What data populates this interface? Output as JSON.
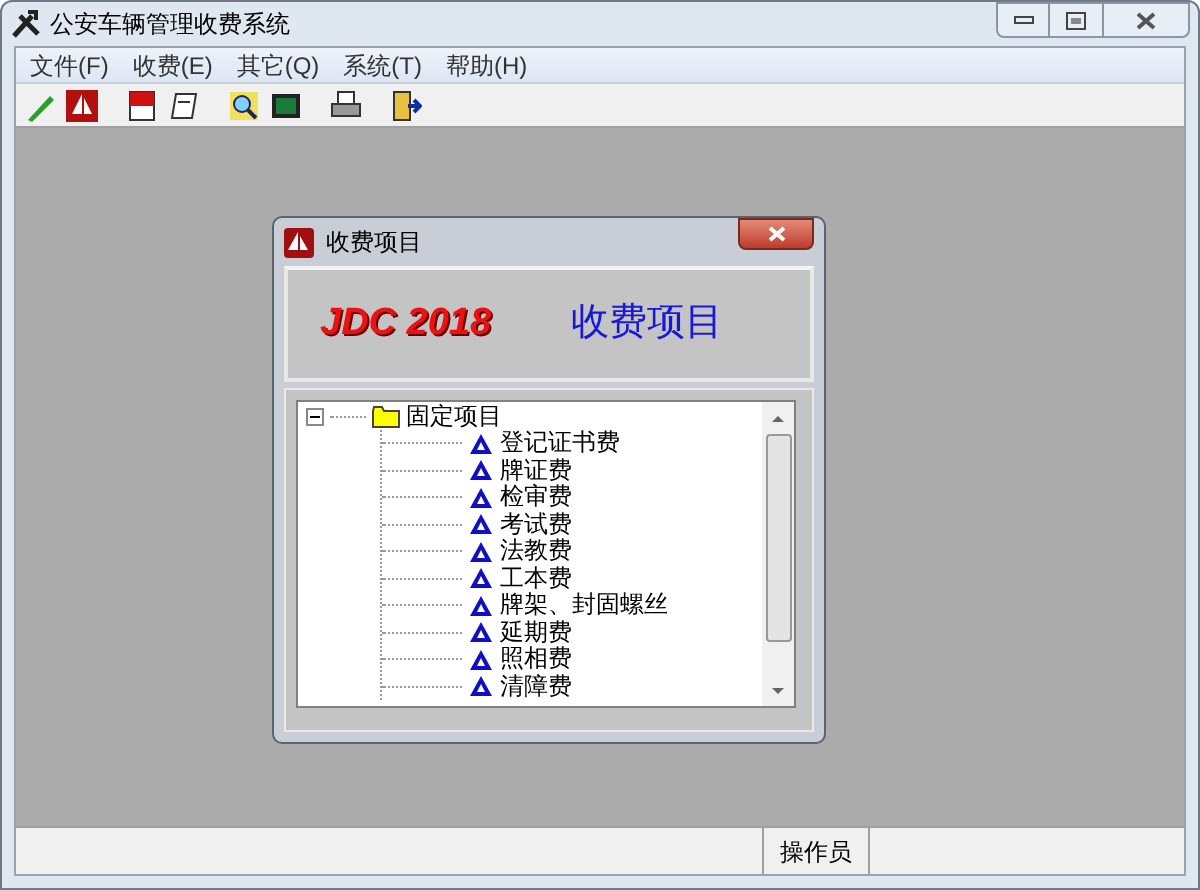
{
  "window": {
    "title": "公安车辆管理收费系统"
  },
  "menu": [
    {
      "label": "文件(F)"
    },
    {
      "label": "收费(E)"
    },
    {
      "label": "其它(Q)"
    },
    {
      "label": "系统(T)"
    },
    {
      "label": "帮助(H)"
    }
  ],
  "dialog": {
    "title": "收费项目",
    "brand": "JDC 2018",
    "heading": "收费项目",
    "tree": [
      {
        "label": "固定项目",
        "expanded": true,
        "children": [
          {
            "label": "登记证书费"
          },
          {
            "label": "牌证费"
          },
          {
            "label": "检审费"
          },
          {
            "label": "考试费"
          },
          {
            "label": "法教费"
          },
          {
            "label": "工本费"
          },
          {
            "label": "牌架、封固螺丝"
          },
          {
            "label": "延期费"
          },
          {
            "label": "照相费"
          },
          {
            "label": "清障费"
          }
        ]
      }
    ]
  },
  "status_bar": [
    {
      "text": "操作员"
    }
  ]
}
